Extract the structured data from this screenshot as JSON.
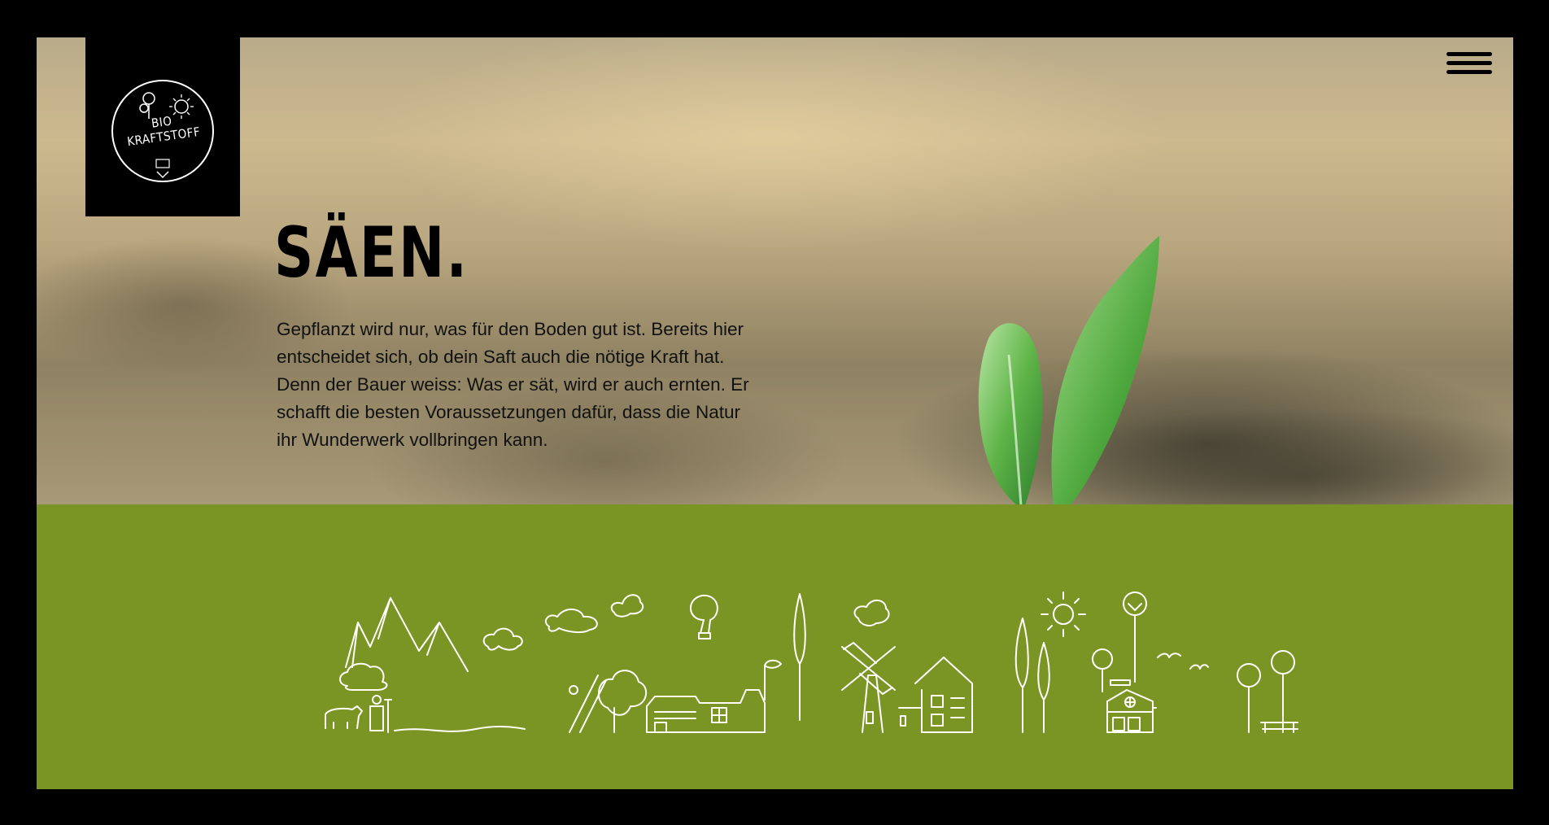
{
  "logo": {
    "line1": "BIO",
    "line2": "KRAFTSTOFF"
  },
  "hero": {
    "title": "SÄEN.",
    "text": "Gepflanzt wird nur, was für den Boden gut ist. Bereits hier entscheidet sich, ob dein Saft auch die nötige Kraft hat. Denn der Bauer weiss: Was er sät, wird er auch ernten. Er schafft die besten Voraussetzungen dafür, dass die Natur ihr Wunderwerk vollbringen kann."
  },
  "colors": {
    "band": "#7a9523",
    "frame": "#000000",
    "leaf": "#6cbf55"
  },
  "icons": [
    "hamburger-menu-icon",
    "logo-emblem-icon",
    "landscape-illustration"
  ]
}
